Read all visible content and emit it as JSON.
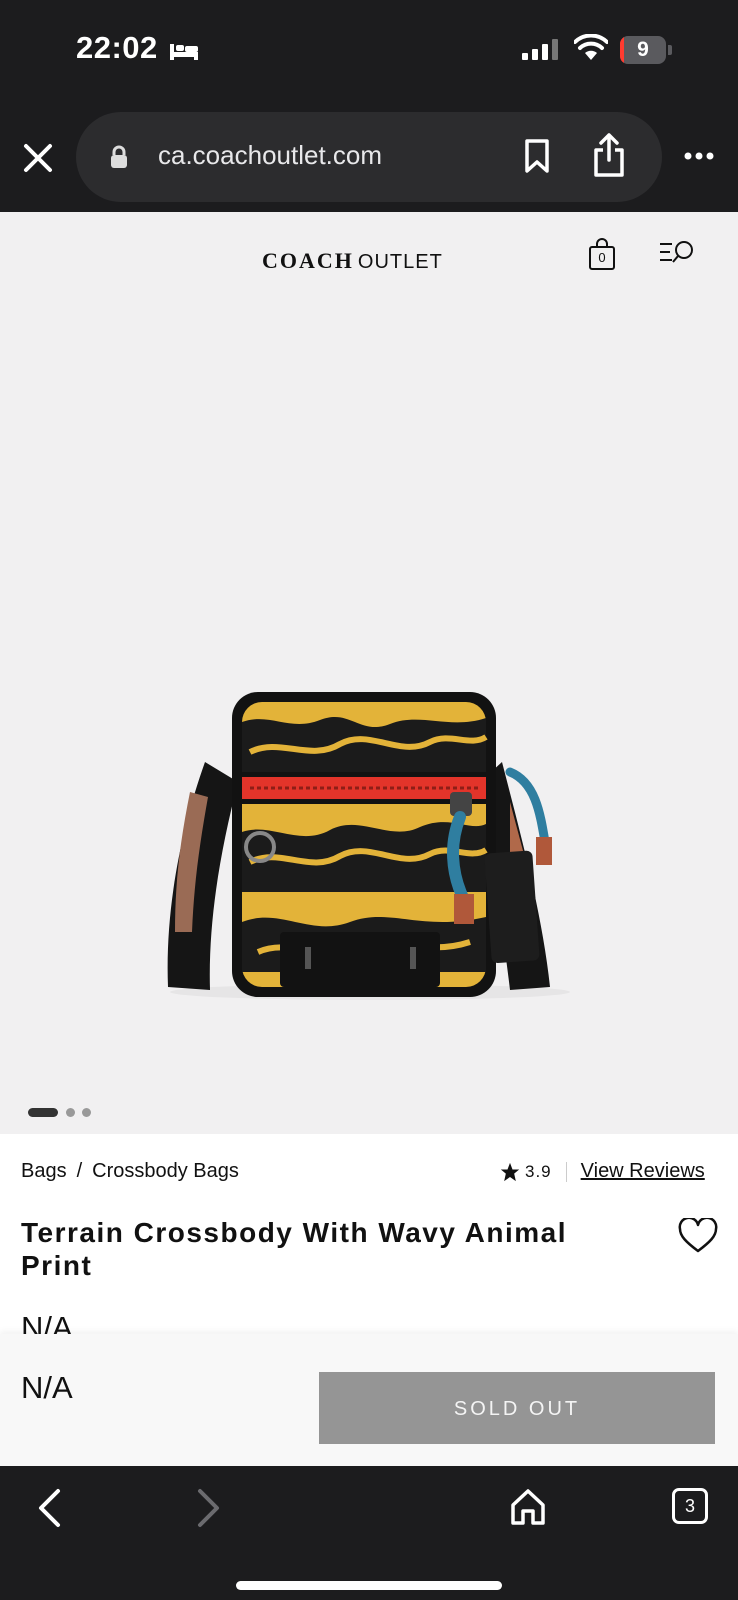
{
  "status_bar": {
    "time": "22:02",
    "battery_level": "9",
    "battery_fraction": 0.09,
    "icons": [
      "bed-icon",
      "cellular-signal-icon",
      "wifi-icon",
      "battery-icon"
    ]
  },
  "browser": {
    "url": "ca.coachoutlet.com",
    "icons": [
      "close-icon",
      "lock-icon",
      "bookmark-icon",
      "share-icon",
      "more-icon"
    ]
  },
  "site_header": {
    "logo_brand": "COACH",
    "logo_suffix": "OUTLET",
    "bag_count": "0",
    "icons": [
      "shopping-bag-icon",
      "menu-search-icon"
    ]
  },
  "product": {
    "image_description_icon": "product-image",
    "carousel": {
      "total": 3,
      "active": 1
    },
    "breadcrumb": [
      "Bags",
      "Crossbody Bags"
    ],
    "breadcrumb_separator": "/",
    "rating": "3.9",
    "reviews_link": "View Reviews",
    "title": "Terrain Crossbody With Wavy Animal Print",
    "price": "N/A"
  },
  "sticky_bar": {
    "price": "N/A",
    "button_label": "SOLD OUT"
  },
  "bottom_bar": {
    "tab_count": "3",
    "icons": [
      "back-icon",
      "forward-icon",
      "home-icon",
      "tabs-icon"
    ]
  },
  "colors": {
    "background_dark": "#1c1c1e",
    "page_bg": "#f1f0f1",
    "sold_out_button": "#959595",
    "battery_low": "#ff3b30"
  }
}
